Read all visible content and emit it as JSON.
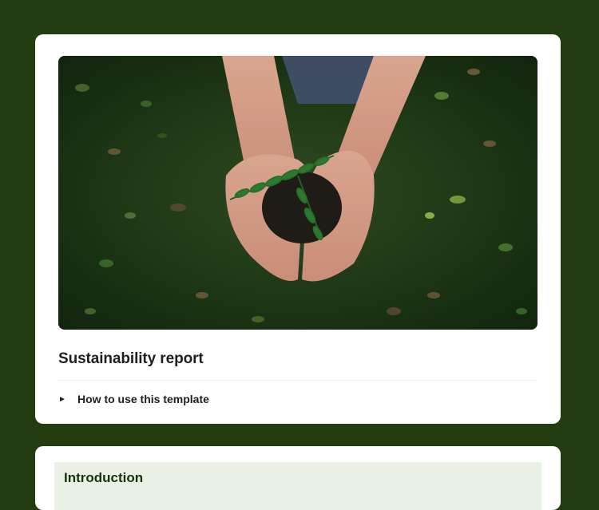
{
  "template": {
    "title": "Sustainability report",
    "toggle_label": "How to use this template",
    "toggle_icon": "collapsed-triangle-icon"
  },
  "hero": {
    "image_subject": "hands-holding-seedling-image"
  },
  "intro_section": {
    "title": "Introduction"
  },
  "colors": {
    "page_background": "#243d10",
    "card_background": "#ffffff",
    "section_header_background": "#e9f0e5",
    "text": "#1f1f1f"
  }
}
